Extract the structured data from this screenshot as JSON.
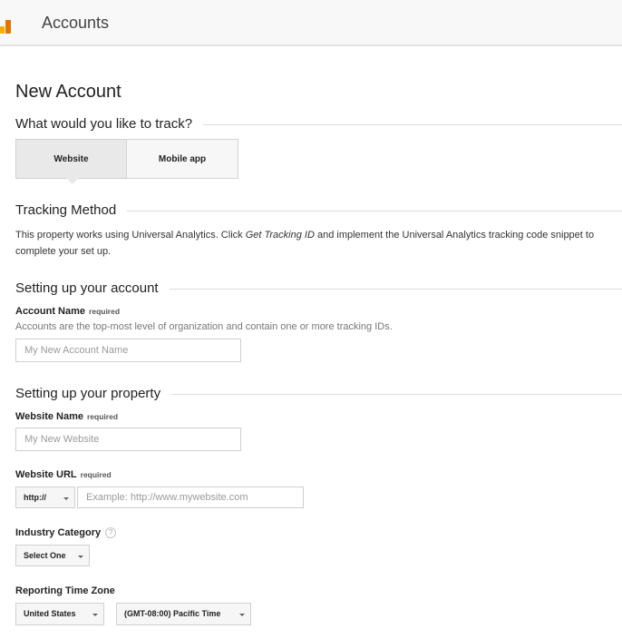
{
  "header": {
    "title": "Accounts"
  },
  "page_title": "New Account",
  "track_section": {
    "heading": "What would you like to track?",
    "options": [
      "Website",
      "Mobile app"
    ],
    "selected": "Website"
  },
  "tracking_method": {
    "heading": "Tracking Method",
    "text_before": "This property works using Universal Analytics. Click ",
    "link_text": "Get Tracking ID",
    "text_after": " and implement the Universal Analytics tracking code snippet to complete your set up."
  },
  "account_section": {
    "heading": "Setting up your account",
    "account_name": {
      "label": "Account Name",
      "required": "required",
      "help": "Accounts are the top-most level of organization and contain one or more tracking IDs.",
      "placeholder": "My New Account Name",
      "value": ""
    }
  },
  "property_section": {
    "heading": "Setting up your property",
    "website_name": {
      "label": "Website Name",
      "required": "required",
      "placeholder": "My New Website",
      "value": ""
    },
    "website_url": {
      "label": "Website URL",
      "required": "required",
      "protocol": "http://",
      "placeholder": "Example: http://www.mywebsite.com",
      "value": ""
    },
    "industry_category": {
      "label": "Industry Category",
      "help_glyph": "?",
      "selected": "Select One"
    },
    "reporting_time_zone": {
      "label": "Reporting Time Zone",
      "country": "United States",
      "zone": "(GMT-08:00) Pacific Time"
    }
  },
  "colors": {
    "logo_orange": "#f9ab00",
    "logo_dark_orange": "#e37400",
    "header_bg": "#f8f8f8",
    "selected_option_bg": "#e9e9e9"
  },
  "icons": {
    "logo": "analytics-logo-icon",
    "dropdown": "chevron-down-icon",
    "help": "help-circle-icon"
  }
}
